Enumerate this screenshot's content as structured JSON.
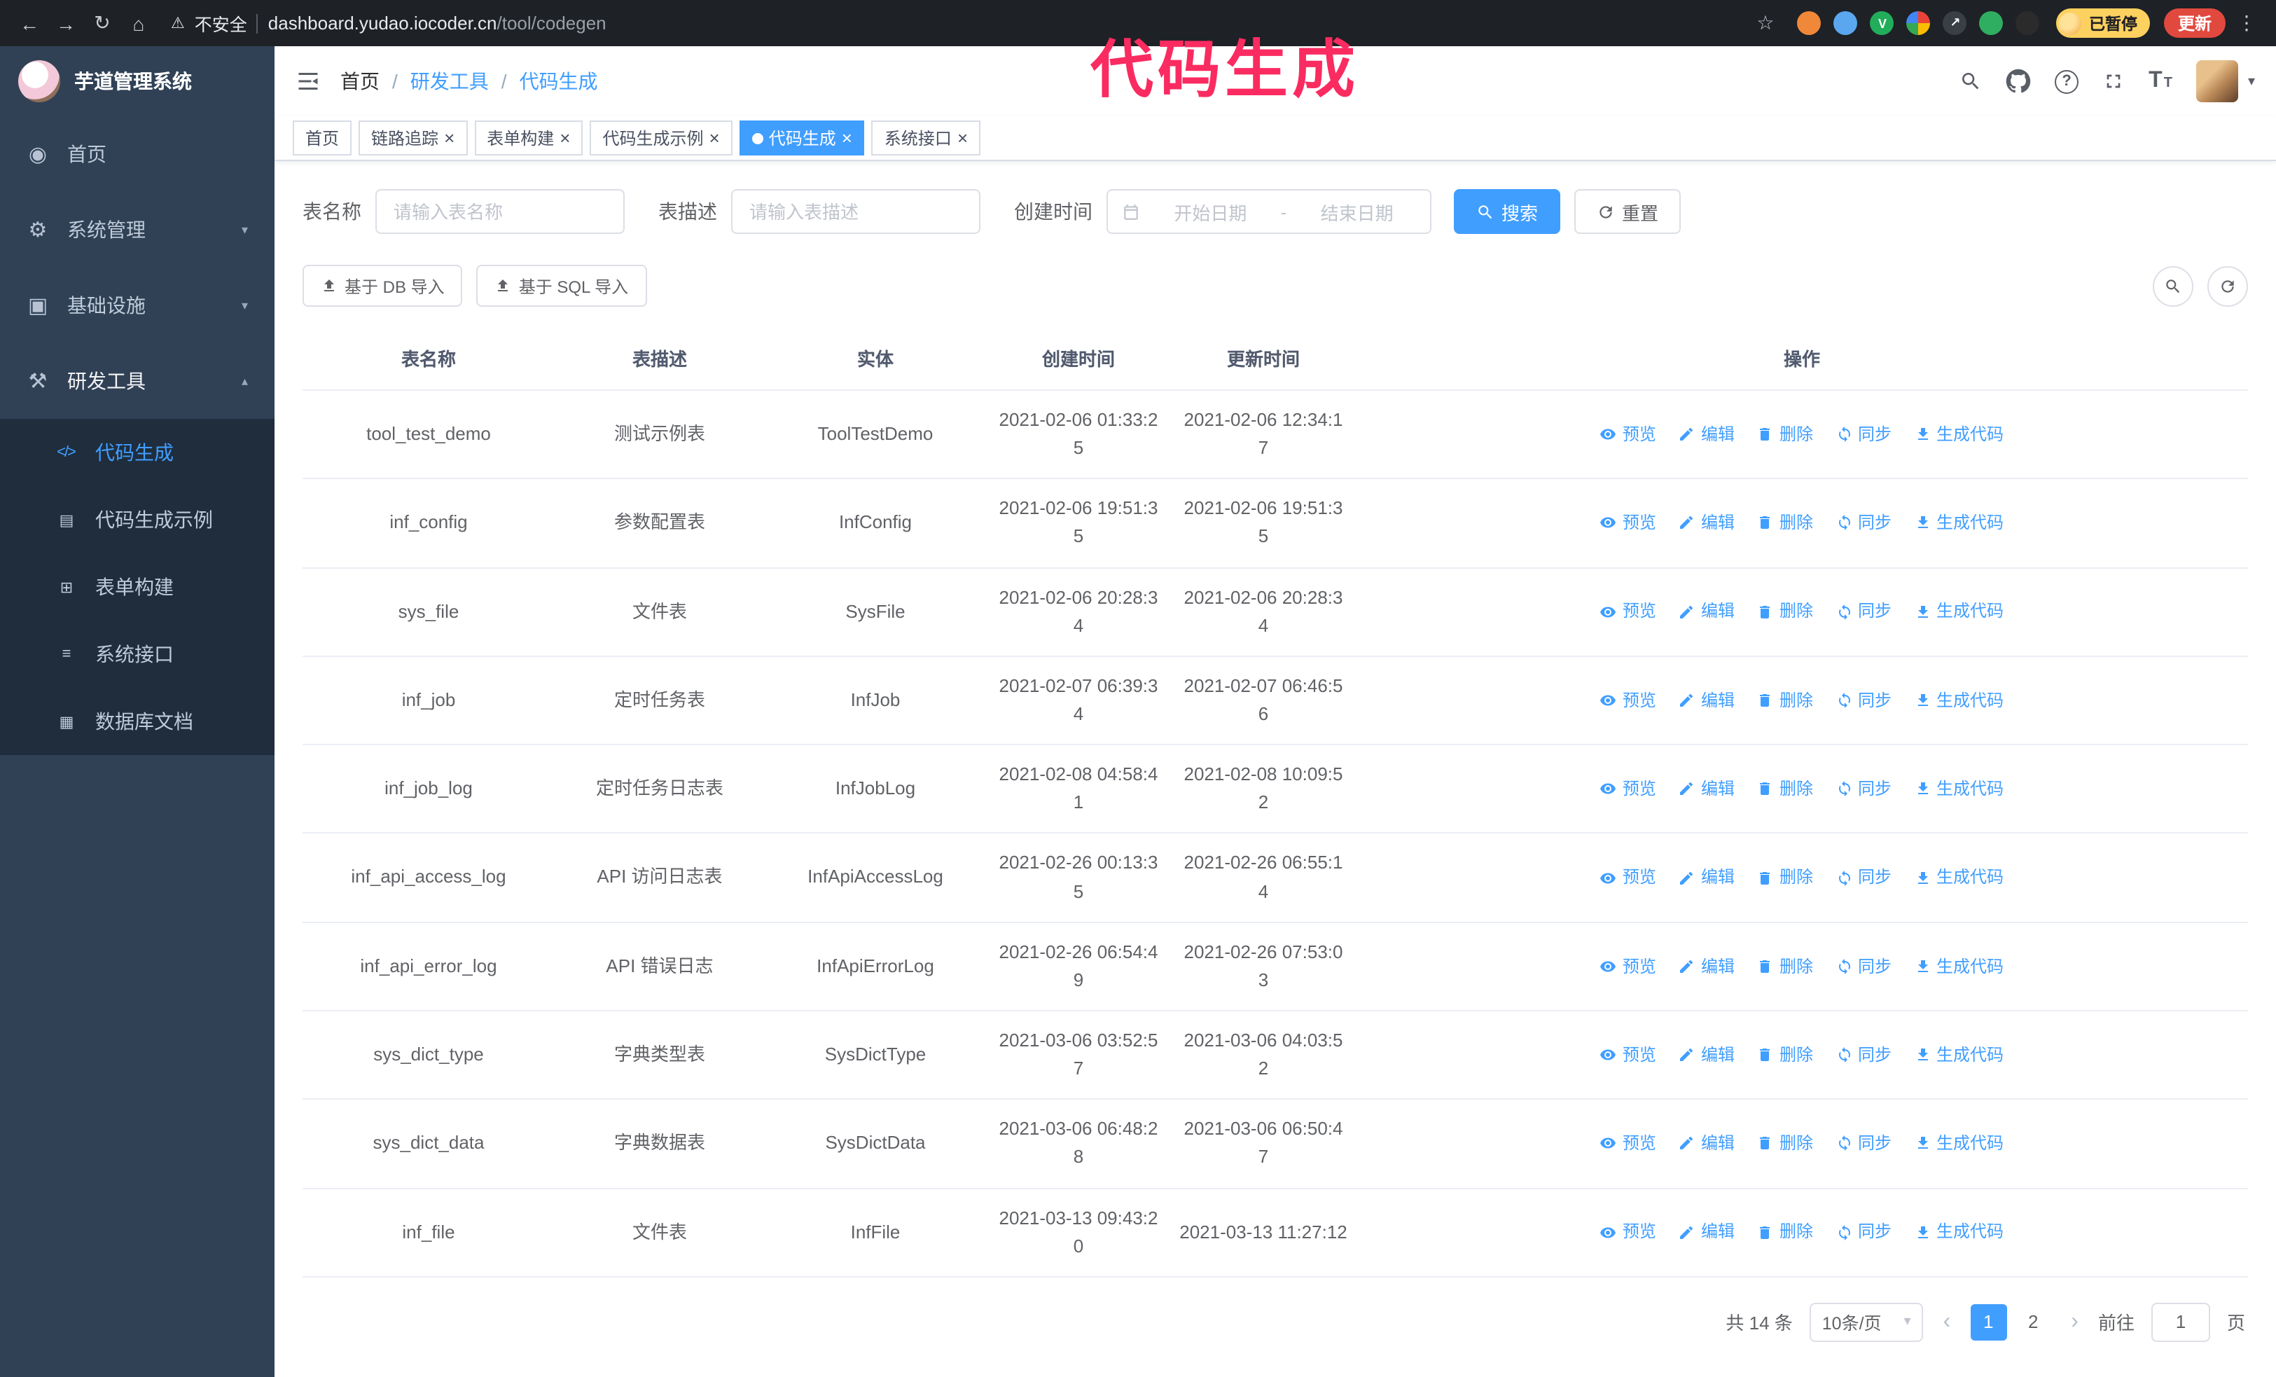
{
  "annotation": {
    "text": "代码生成"
  },
  "icons": {
    "back": "←",
    "forward": "→",
    "reload": "↻",
    "home": "⌂",
    "warning": "⚠",
    "star": "☆",
    "dots": "⋮",
    "caret": "▾",
    "close": "×",
    "question": "?",
    "t_big": "T",
    "t_small": "T",
    "prev": "‹",
    "next": "›"
  },
  "browser": {
    "warning": "不安全",
    "domain": "dashboard.yudao.iocoder.cn",
    "path": "/tool/codegen",
    "paused": "已暂停",
    "update": "更新",
    "extensions": [
      {
        "color": "#f0883a",
        "glyph": ""
      },
      {
        "color": "#5aa7f0",
        "glyph": ""
      },
      {
        "color": "#21ad5a",
        "glyph": "V"
      },
      {
        "color": "conic-gradient(#ea4335 0 25%,#fbbc04 0 50%,#34a853 0 75%,#4285f4 0)",
        "glyph": ""
      },
      {
        "color": "#3a3f45",
        "glyph": "↗"
      },
      {
        "color": "#2fae62",
        "glyph": ""
      },
      {
        "color": "#2b2b2b",
        "glyph": ""
      }
    ]
  },
  "sidebar": {
    "title": "芋道管理系统",
    "items": [
      {
        "label": "首页",
        "glyph": "◉"
      },
      {
        "label": "系统管理",
        "glyph": "⚙",
        "chevron": "▾"
      },
      {
        "label": "基础设施",
        "glyph": "▣",
        "chevron": "▾"
      },
      {
        "label": "研发工具",
        "glyph": "⚒",
        "chevron": "▴",
        "active": true
      }
    ],
    "submenu": [
      {
        "label": "代码生成",
        "glyph": "</>",
        "active": true
      },
      {
        "label": "代码生成示例",
        "glyph": "▤"
      },
      {
        "label": "表单构建",
        "glyph": "⊞"
      },
      {
        "label": "系统接口",
        "glyph": "≡"
      },
      {
        "label": "数据库文档",
        "glyph": "▦"
      }
    ]
  },
  "header": {
    "breadcrumb": [
      {
        "label": "首页",
        "sep": "/",
        "muted": true
      },
      {
        "label": "研发工具",
        "sep": "/"
      },
      {
        "label": "代码生成",
        "sep": ""
      }
    ]
  },
  "tabs": [
    {
      "label": "首页",
      "closable": false
    },
    {
      "label": "链路追踪"
    },
    {
      "label": "表单构建"
    },
    {
      "label": "代码生成示例"
    },
    {
      "label": "代码生成",
      "active": true
    },
    {
      "label": "系统接口"
    }
  ],
  "filters": {
    "name_label": "表名称",
    "name_placeholder": "请输入表名称",
    "desc_label": "表描述",
    "desc_placeholder": "请输入表描述",
    "time_label": "创建时间",
    "start_placeholder": "开始日期",
    "separator": "-",
    "end_placeholder": "结束日期",
    "search": "搜索",
    "reset": "重置"
  },
  "toolbar": {
    "db_import": "基于 DB 导入",
    "sql_import": "基于 SQL 导入"
  },
  "table": {
    "columns": [
      {
        "label": "表名称"
      },
      {
        "label": "表描述"
      },
      {
        "label": "实体"
      },
      {
        "label": "创建时间"
      },
      {
        "label": "更新时间"
      },
      {
        "label": "操作"
      }
    ],
    "rows": [
      {
        "name": "tool_test_demo",
        "desc": "测试示例表",
        "entity": "ToolTestDemo",
        "created": "2021-02-06 01:33:25",
        "updated": "2021-02-06 12:34:17"
      },
      {
        "name": "inf_config",
        "desc": "参数配置表",
        "entity": "InfConfig",
        "created": "2021-02-06 19:51:35",
        "updated": "2021-02-06 19:51:35"
      },
      {
        "name": "sys_file",
        "desc": "文件表",
        "entity": "SysFile",
        "created": "2021-02-06 20:28:34",
        "updated": "2021-02-06 20:28:34"
      },
      {
        "name": "inf_job",
        "desc": "定时任务表",
        "entity": "InfJob",
        "created": "2021-02-07 06:39:34",
        "updated": "2021-02-07 06:46:56"
      },
      {
        "name": "inf_job_log",
        "desc": "定时任务日志表",
        "entity": "InfJobLog",
        "created": "2021-02-08 04:58:41",
        "updated": "2021-02-08 10:09:52"
      },
      {
        "name": "inf_api_access_log",
        "desc": "API 访问日志表",
        "entity": "InfApiAccessLog",
        "created": "2021-02-26 00:13:35",
        "updated": "2021-02-26 06:55:14"
      },
      {
        "name": "inf_api_error_log",
        "desc": "API 错误日志",
        "entity": "InfApiErrorLog",
        "created": "2021-02-26 06:54:49",
        "updated": "2021-02-26 07:53:03"
      },
      {
        "name": "sys_dict_type",
        "desc": "字典类型表",
        "entity": "SysDictType",
        "created": "2021-03-06 03:52:57",
        "updated": "2021-03-06 04:03:52"
      },
      {
        "name": "sys_dict_data",
        "desc": "字典数据表",
        "entity": "SysDictData",
        "created": "2021-03-06 06:48:28",
        "updated": "2021-03-06 06:50:47"
      },
      {
        "name": "inf_file",
        "desc": "文件表",
        "entity": "InfFile",
        "created": "2021-03-13 09:43:20",
        "updated": "2021-03-13 11:27:12"
      }
    ]
  },
  "actions": {
    "preview": "预览",
    "edit": "编辑",
    "delete": "删除",
    "sync": "同步",
    "generate": "生成代码"
  },
  "pagination": {
    "total": "共 14 条",
    "size": "10条/页",
    "pages": [
      {
        "label": "1",
        "active": true
      },
      {
        "label": "2"
      }
    ],
    "goto": "前往",
    "goto_value": "1",
    "unit": "页"
  }
}
